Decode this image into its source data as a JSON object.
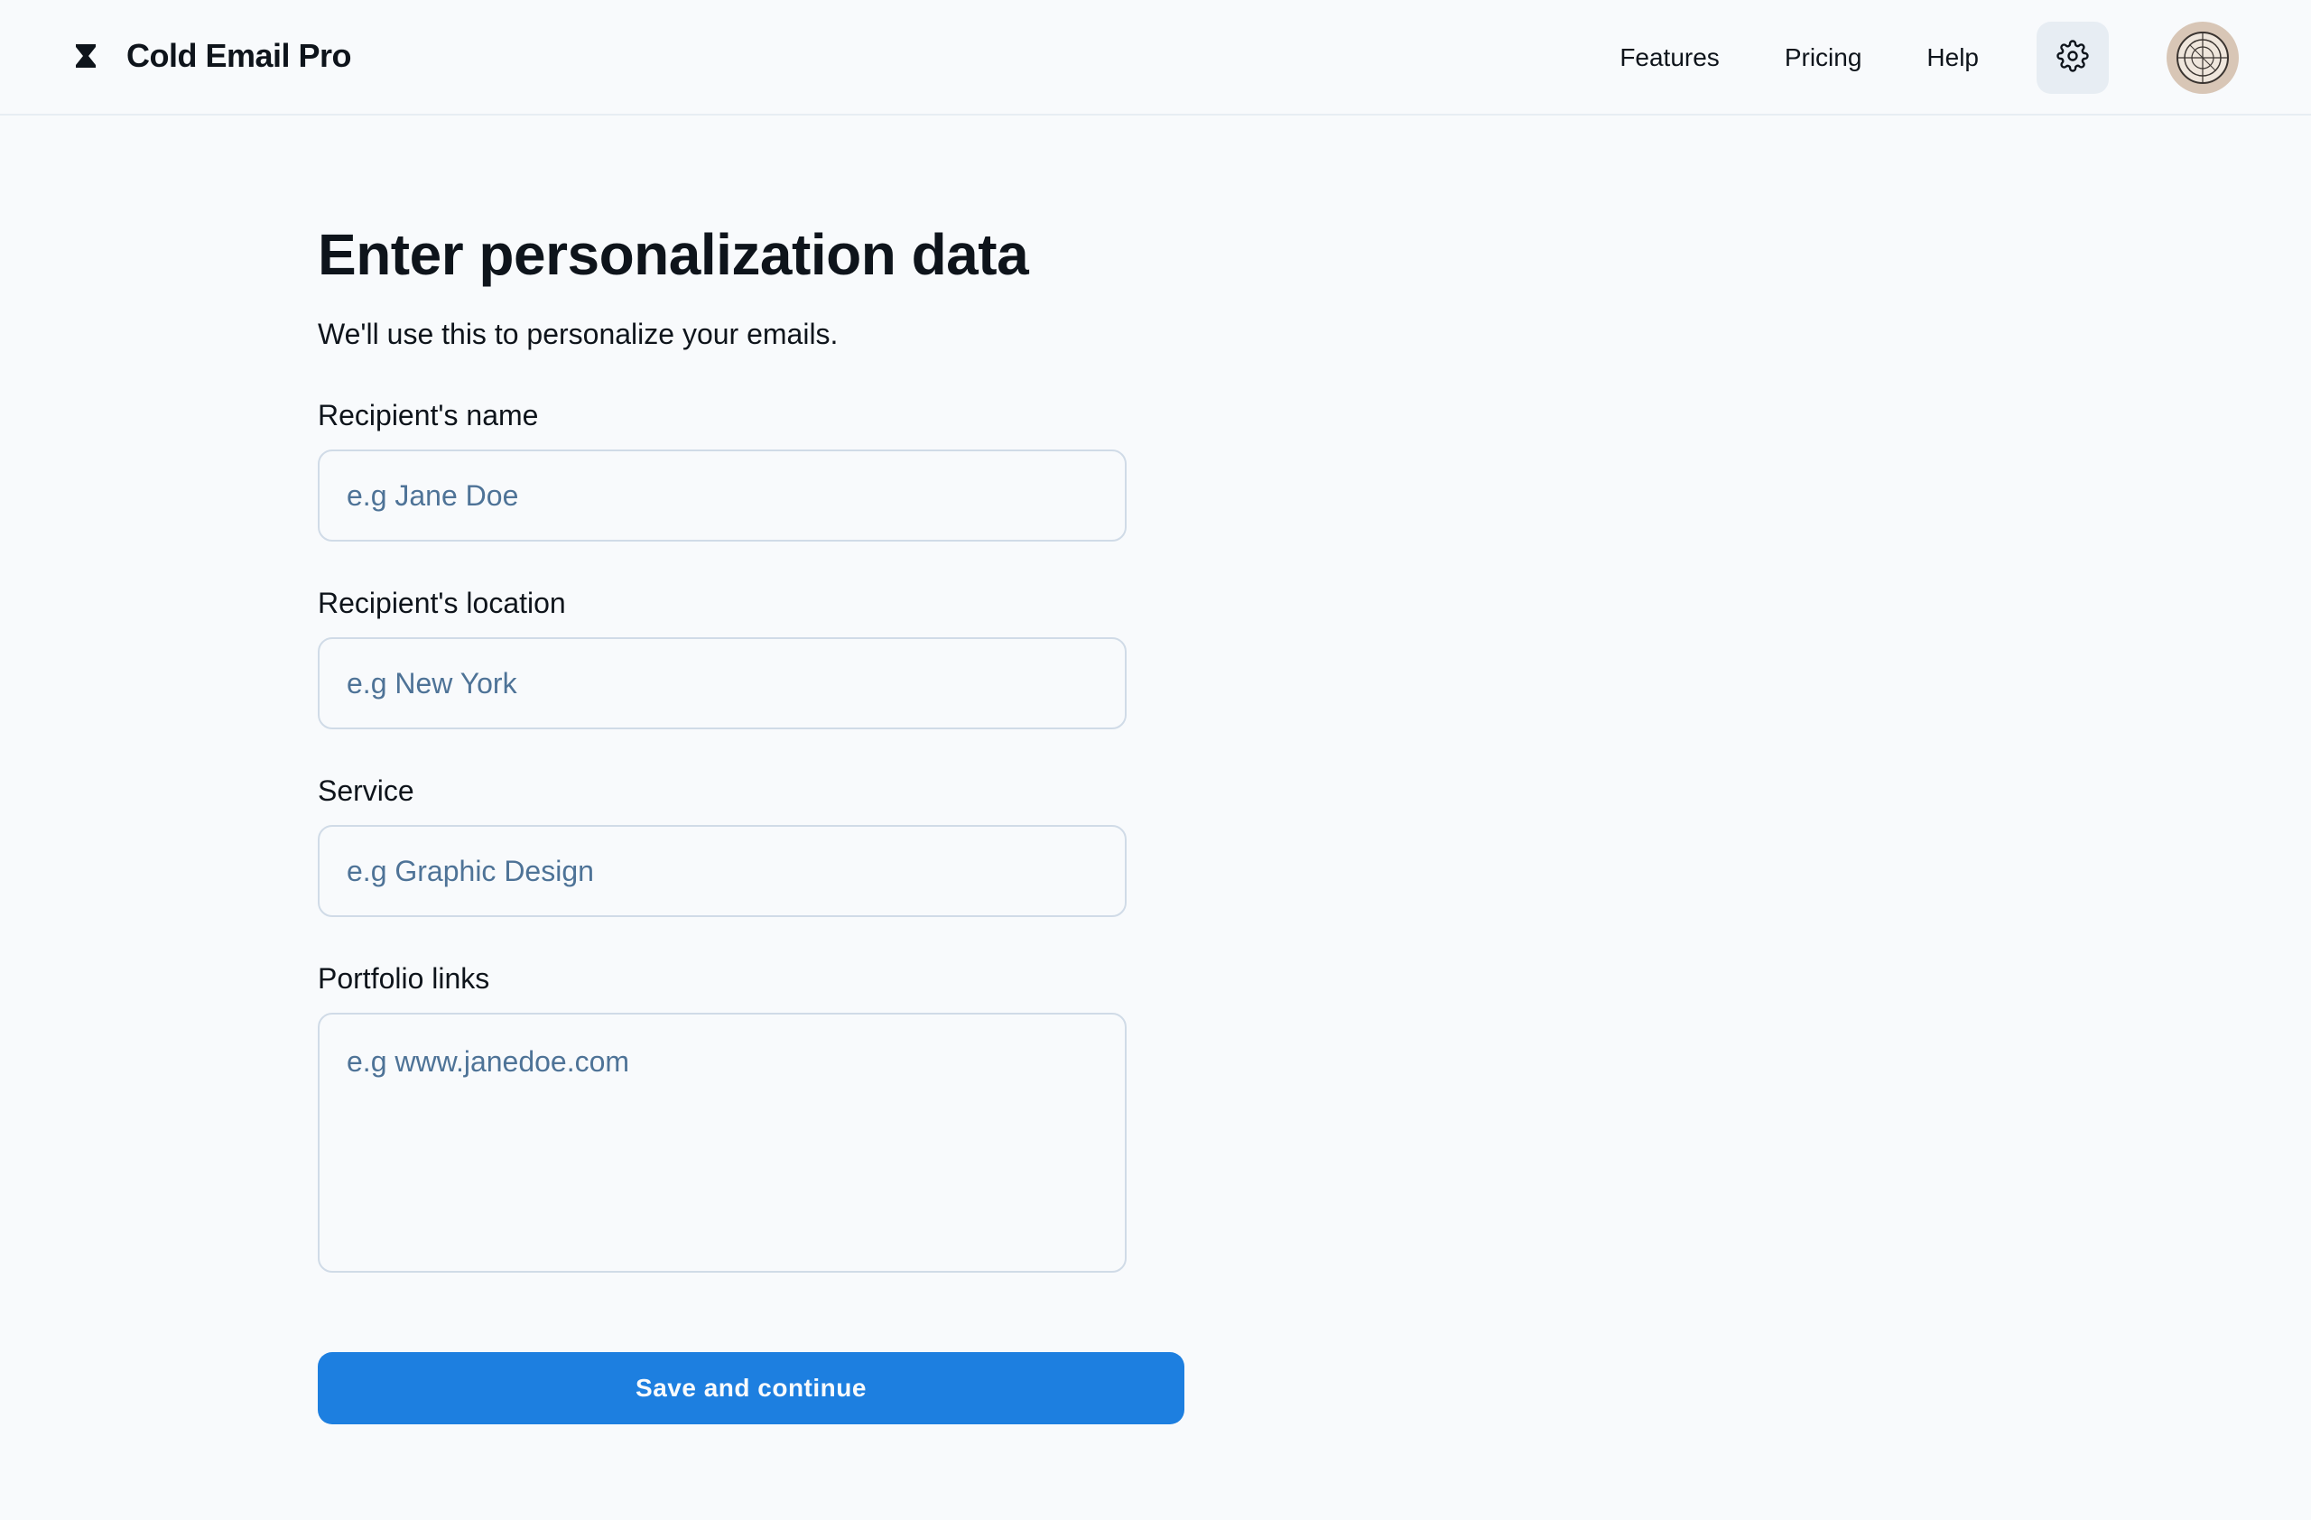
{
  "header": {
    "brand": "Cold Email Pro",
    "brand_icon": "hourglass-logo-icon",
    "nav": [
      "Features",
      "Pricing",
      "Help"
    ],
    "settings_icon": "gear-icon",
    "avatar": "user-avatar"
  },
  "main": {
    "title": "Enter personalization data",
    "subtitle": "We'll use this to personalize your emails.",
    "fields": [
      {
        "label": "Recipient's name",
        "placeholder": "e.g Jane Doe",
        "value": ""
      },
      {
        "label": "Recipient's location",
        "placeholder": "e.g New York",
        "value": ""
      },
      {
        "label": "Service",
        "placeholder": "e.g Graphic Design",
        "value": ""
      },
      {
        "label": "Portfolio links",
        "placeholder": "e.g www.janedoe.com",
        "value": ""
      }
    ],
    "save_label": "Save and continue"
  },
  "colors": {
    "background": "#f8fafc",
    "text": "#0e141b",
    "placeholder": "#4e7397",
    "border": "#d0dbe7",
    "primary": "#1d7fe0",
    "settings_bg": "#e7edf3"
  }
}
